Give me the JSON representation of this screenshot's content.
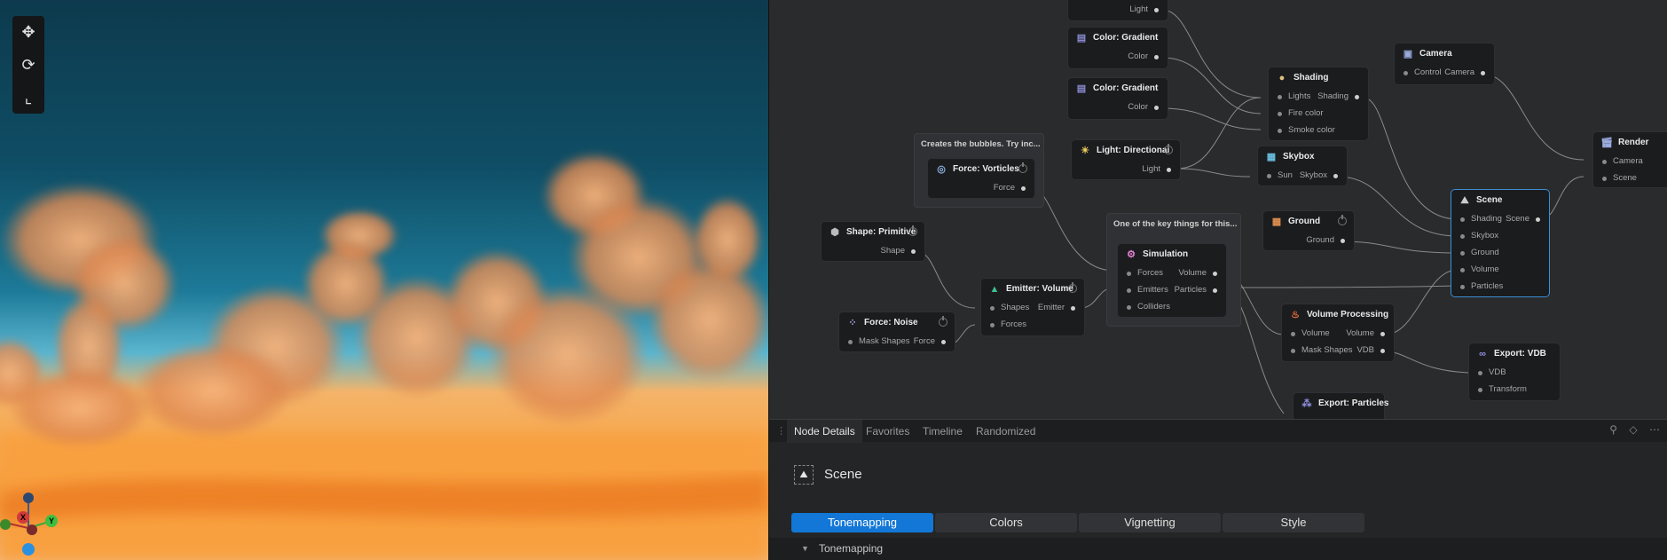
{
  "viewport": {
    "tools": [
      {
        "name": "move",
        "icon": "move-icon"
      },
      {
        "name": "rotate",
        "icon": "rotate-icon"
      },
      {
        "name": "axes",
        "icon": "axes-icon"
      }
    ],
    "gizmo": {
      "x_label": "X",
      "y_label": "Y"
    },
    "colors": {
      "sky": "#0f4e66",
      "fire": "#f49a3c"
    }
  },
  "graph": {
    "comments": [
      {
        "title": "Creates the bubbles. Try inc..."
      },
      {
        "title": "One of the key things for this..."
      }
    ],
    "nodes": {
      "light_top": {
        "outputs": [
          "Light"
        ]
      },
      "color_gradient_1": {
        "title": "Color: Gradient",
        "outputs": [
          "Color"
        ]
      },
      "color_gradient_2": {
        "title": "Color: Gradient",
        "outputs": [
          "Color"
        ]
      },
      "shading": {
        "title": "Shading",
        "inputs": [
          "Lights",
          "Fire color",
          "Smoke color"
        ],
        "outputs": [
          "Shading"
        ]
      },
      "camera": {
        "title": "Camera",
        "inputs": [
          "Control"
        ],
        "outputs": [
          "Camera"
        ]
      },
      "render": {
        "title": "Render",
        "inputs": [
          "Camera",
          "Scene"
        ]
      },
      "force_vorticles": {
        "title": "Force: Vorticles",
        "outputs": [
          "Force"
        ]
      },
      "light_directional": {
        "title": "Light: Directional",
        "outputs": [
          "Light"
        ]
      },
      "skybox": {
        "title": "Skybox",
        "inputs": [
          "Sun"
        ],
        "outputs": [
          "Skybox"
        ]
      },
      "scene": {
        "title": "Scene",
        "inputs": [
          "Shading",
          "Skybox",
          "Ground",
          "Volume",
          "Particles"
        ],
        "outputs": [
          "Scene"
        ]
      },
      "ground": {
        "title": "Ground",
        "outputs": [
          "Ground"
        ]
      },
      "shape_primitive": {
        "title": "Shape: Primitive",
        "outputs": [
          "Shape"
        ]
      },
      "simulation": {
        "title": "Simulation",
        "inputs": [
          "Forces",
          "Emitters",
          "Colliders"
        ],
        "outputs": [
          "Volume",
          "Particles"
        ]
      },
      "emitter_volume": {
        "title": "Emitter: Volume",
        "inputs": [
          "Shapes",
          "Forces"
        ],
        "outputs": [
          "Emitter"
        ]
      },
      "force_noise": {
        "title": "Force: Noise",
        "inputs": [
          "Mask Shapes"
        ],
        "outputs": [
          "Force"
        ]
      },
      "volume_processing": {
        "title": "Volume Processing",
        "inputs": [
          "Volume",
          "Mask Shapes"
        ],
        "outputs": [
          "Volume",
          "VDB"
        ]
      },
      "export_vdb": {
        "title": "Export: VDB",
        "inputs": [
          "VDB",
          "Transform"
        ]
      },
      "export_particles": {
        "title": "Export: Particles"
      }
    }
  },
  "details": {
    "tabs": [
      "Node Details",
      "Favorites",
      "Timeline",
      "Randomized"
    ],
    "active_tab": "Node Details",
    "selected_node": "Scene",
    "segments": [
      "Tonemapping",
      "Colors",
      "Vignetting",
      "Style"
    ],
    "active_segment": "Tonemapping",
    "section_title": "Tonemapping"
  }
}
